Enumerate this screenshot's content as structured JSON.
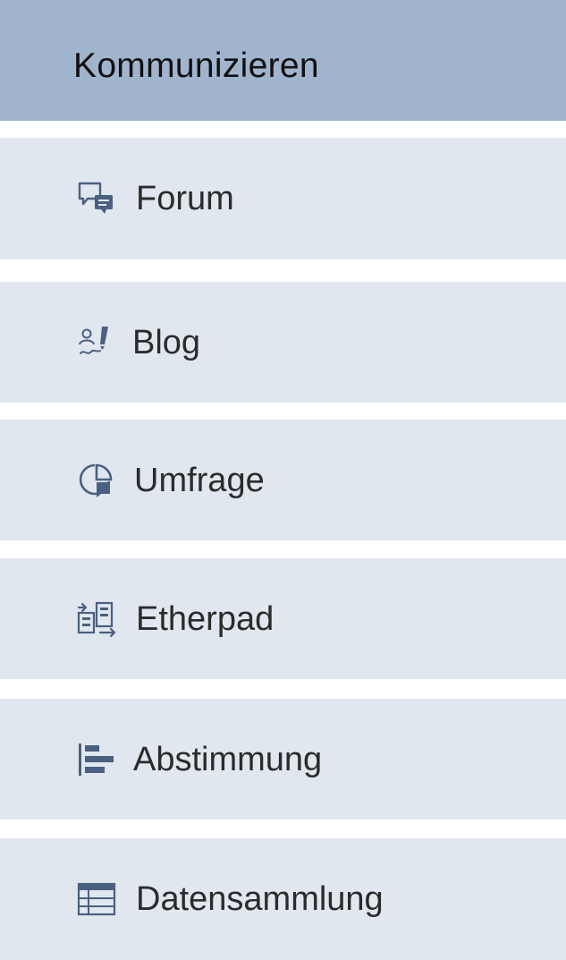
{
  "header": {
    "title": "Kommunizieren"
  },
  "items": [
    {
      "label": "Forum",
      "icon": "forum-icon"
    },
    {
      "label": "Blog",
      "icon": "blog-icon"
    },
    {
      "label": "Umfrage",
      "icon": "survey-icon"
    },
    {
      "label": "Etherpad",
      "icon": "etherpad-icon"
    },
    {
      "label": "Abstimmung",
      "icon": "poll-icon"
    },
    {
      "label": "Datensammlung",
      "icon": "data-collection-icon"
    }
  ],
  "colors": {
    "header_bg": "#a1b4cd",
    "item_bg": "#e1e7ef",
    "icon": "#4a6080",
    "text": "#2b2b2b"
  }
}
